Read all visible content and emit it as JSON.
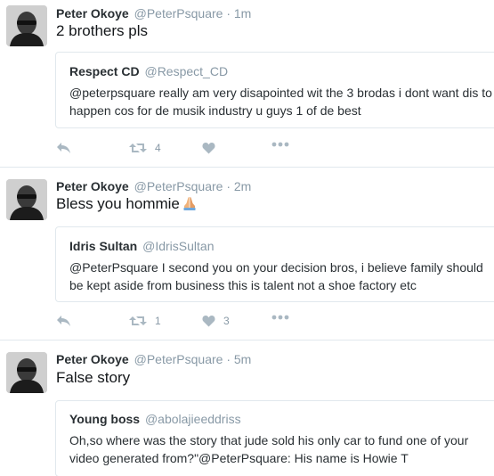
{
  "tweets": [
    {
      "name": "Peter Okoye",
      "handle": "@PeterPsquare",
      "dot": "·",
      "time": "1m",
      "text": "2 brothers pls",
      "emoji": "",
      "quote": {
        "name": "Respect CD",
        "handle": "@Respect_CD",
        "text": "@peterpsquare really am very disapointed wit the 3 brodas i dont want dis to happen cos for de musik industry u guys 1 of de best"
      },
      "actions": {
        "retweets": "4",
        "likes": ""
      }
    },
    {
      "name": "Peter Okoye",
      "handle": "@PeterPsquare",
      "dot": "·",
      "time": "2m",
      "text": "Bless you hommie",
      "emoji": "folded-hands-emoji",
      "quote": {
        "name": "Idris Sultan",
        "handle": "@IdrisSultan",
        "text": "@PeterPsquare I second you on your decision bros, i believe family should be kept aside from business this is talent not a shoe factory etc"
      },
      "actions": {
        "retweets": "1",
        "likes": "3"
      }
    },
    {
      "name": "Peter Okoye",
      "handle": "@PeterPsquare",
      "dot": "·",
      "time": "5m",
      "text": "False story",
      "emoji": "",
      "quote": {
        "name": "Young boss",
        "handle": "@abolajieeddriss",
        "text": "Oh,so where was the story that jude sold his only car to fund one of your video generated from?\"@PeterPsquare: His name is Howie T"
      },
      "actions": {
        "retweets": "",
        "likes": ""
      }
    }
  ],
  "icons": {
    "reply": "reply-icon",
    "retweet": "retweet-icon",
    "like": "heart-icon",
    "more": "more-dots-icon"
  },
  "colors": {
    "icon": "#aab8c2",
    "meta": "#8899a6",
    "border": "#e1e8ed"
  }
}
